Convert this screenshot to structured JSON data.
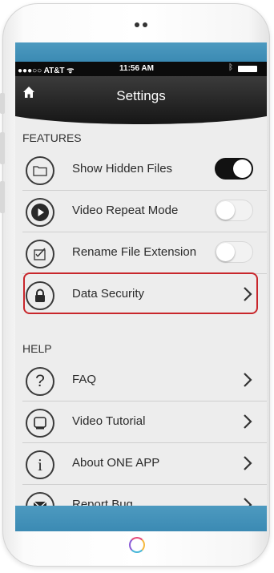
{
  "status_bar": {
    "carrier": "●●●○○ AT&T ᯤ",
    "time": "11:56 AM"
  },
  "nav": {
    "title": "Settings"
  },
  "features": {
    "header": "FEATURES",
    "items": [
      {
        "label": "Show Hidden Files",
        "icon": "folder-icon",
        "control": "toggle",
        "state": "on"
      },
      {
        "label": "Video Repeat Mode",
        "icon": "play-icon",
        "control": "toggle",
        "state": "off"
      },
      {
        "label": "Rename File Extension",
        "icon": "edit-file-icon",
        "control": "toggle",
        "state": "off"
      },
      {
        "label": "Data Security",
        "icon": "lock-icon",
        "control": "chevron",
        "highlighted": true
      }
    ]
  },
  "help": {
    "header": "HELP",
    "items": [
      {
        "label": "FAQ",
        "icon": "question-icon"
      },
      {
        "label": "Video Tutorial",
        "icon": "video-screen-icon"
      },
      {
        "label": "About ONE APP",
        "icon": "info-icon"
      },
      {
        "label": "Report Bug",
        "icon": "mail-icon"
      }
    ]
  },
  "colors": {
    "accent_blue": "#3b8ab3",
    "highlight_red": "#c8262b",
    "nav_dark": "#161616"
  }
}
